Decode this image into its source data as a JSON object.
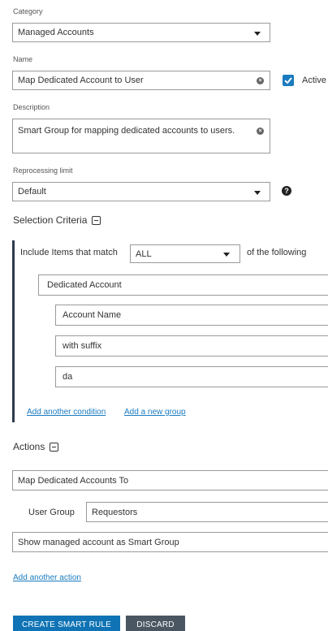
{
  "category": {
    "label": "Category",
    "value": "Managed Accounts"
  },
  "name": {
    "label": "Name",
    "value": "Map Dedicated Account to User",
    "active_label": "Active",
    "active_checked": true
  },
  "description": {
    "label": "Description",
    "value": "Smart Group for mapping dedicated accounts to users."
  },
  "reprocessing": {
    "label": "Reprocessing limit",
    "value": "Default"
  },
  "selection": {
    "title": "Selection Criteria",
    "include_prefix": "Include Items that match",
    "match_value": "ALL",
    "include_suffix": "of the following",
    "condition": "Dedicated Account",
    "sub_fields": [
      "Account Name",
      "with suffix",
      "da"
    ],
    "add_condition_link": "Add another condition",
    "add_group_link": "Add a new group"
  },
  "actions": {
    "title": "Actions",
    "action1": "Map Dedicated Accounts To",
    "user_group_label": "User Group",
    "user_group_value": "Requestors",
    "action2": "Show managed account as Smart Group",
    "add_action_link": "Add another action"
  },
  "buttons": {
    "create": "CREATE SMART RULE",
    "discard": "DISCARD"
  },
  "colors": {
    "accent": "#1a7bbf",
    "create_bg": "#0f73b5",
    "discard_bg": "#4a5661",
    "border_dark": "#2e3a4e"
  }
}
